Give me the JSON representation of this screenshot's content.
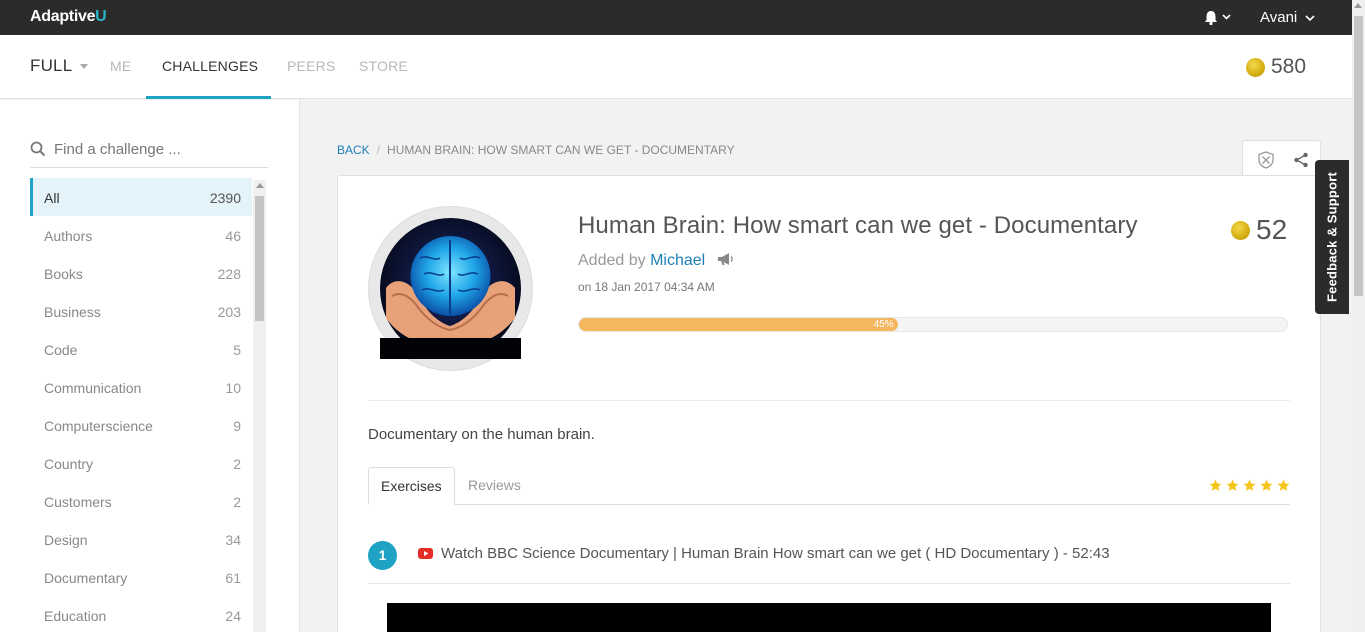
{
  "app": {
    "logo_main": "Adaptive",
    "logo_accent": "U",
    "user_name": "Avani",
    "notification_icon": "bell-icon"
  },
  "nav": {
    "full_label": "FULL",
    "items": [
      {
        "label": "ME"
      },
      {
        "label": "CHALLENGES"
      },
      {
        "label": "PEERS"
      },
      {
        "label": "STORE"
      }
    ],
    "active_index": 1,
    "coins": "580"
  },
  "sidebar": {
    "search_placeholder": "Find a challenge ...",
    "categories": [
      {
        "label": "All",
        "count": "2390"
      },
      {
        "label": "Authors",
        "count": "46"
      },
      {
        "label": "Books",
        "count": "228"
      },
      {
        "label": "Business",
        "count": "203"
      },
      {
        "label": "Code",
        "count": "5"
      },
      {
        "label": "Communication",
        "count": "10"
      },
      {
        "label": "Computerscience",
        "count": "9"
      },
      {
        "label": "Country",
        "count": "2"
      },
      {
        "label": "Customers",
        "count": "2"
      },
      {
        "label": "Design",
        "count": "34"
      },
      {
        "label": "Documentary",
        "count": "61"
      },
      {
        "label": "Education",
        "count": "24"
      }
    ]
  },
  "breadcrumb": {
    "back": "BACK",
    "separator": "/",
    "current": "HUMAN BRAIN: HOW SMART CAN WE GET - DOCUMENTARY"
  },
  "challenge": {
    "title": "Human Brain: How smart can we get - Documentary",
    "added_by_prefix": "Added by",
    "author": "Michael",
    "date": "on 18 Jan 2017 04:34 AM",
    "coins": "52",
    "progress_percent": 45,
    "progress_label": "45%",
    "description": "Documentary on the human brain.",
    "tabs": [
      {
        "label": "Exercises"
      },
      {
        "label": "Reviews"
      }
    ],
    "rating": 5,
    "exercises": [
      {
        "number": "1",
        "title": "Watch BBC Science Documentary | Human Brain How smart can we get ( HD Documentary ) - 52:43"
      }
    ]
  },
  "feedback": {
    "label": "Feedback & Support"
  },
  "colors": {
    "accent": "#1ea3c4",
    "link": "#1e7fb8",
    "progress": "#f5b75d",
    "star": "#f6c519",
    "topbar": "#2b2b2b"
  }
}
